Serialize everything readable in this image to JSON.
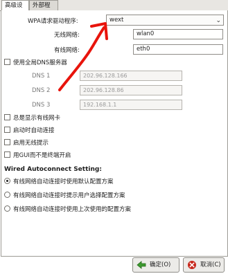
{
  "tabs": [
    {
      "label": "高级设置"
    },
    {
      "label": "外部程序"
    }
  ],
  "fields": {
    "wpa_label": "WPA请求驱动程序:",
    "wpa_value": "wext",
    "wireless_label": "无线网络:",
    "wireless_value": "wlan0",
    "wired_label": "有线网络:",
    "wired_value": "eth0"
  },
  "dns": {
    "checkbox_label": "使用全局DNS服务器",
    "items": [
      {
        "label": "DNS 1",
        "value": "202.96.128.166"
      },
      {
        "label": "DNS 2",
        "value": "202.96.128.86"
      },
      {
        "label": "DNS 3",
        "value": "192.168.1.1"
      }
    ]
  },
  "options": [
    {
      "label": "总是显示有线网卡"
    },
    {
      "label": "启动时自动连接"
    },
    {
      "label": "启用无线提示"
    },
    {
      "label": "用GUI而不是终端开启"
    }
  ],
  "wired_section": {
    "title": "Wired Autoconnect Setting:",
    "radios": [
      {
        "label": "有线网络自动连接时使用默认配置方案",
        "selected": true
      },
      {
        "label": "有线网络自动连接时提示用户选择配置方案",
        "selected": false
      },
      {
        "label": "有线网络自动连接时使用上次使用的配置方案",
        "selected": false
      }
    ]
  },
  "buttons": {
    "ok_label": "确定(O)",
    "cancel_label": "取消(C)"
  },
  "colors": {
    "annotation_arrow": "#e8140c",
    "ok_icon": "#3d9a2f",
    "cancel_icon": "#c8281c"
  }
}
